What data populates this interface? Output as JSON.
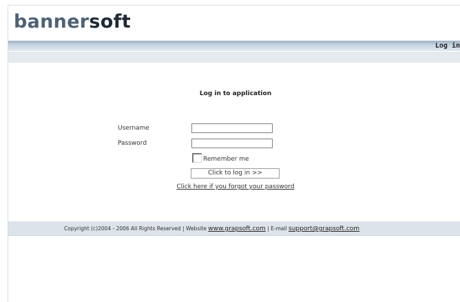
{
  "app": {
    "logo_light": "banner",
    "logo_dark": "soft"
  },
  "header": {
    "login_label": "Log in"
  },
  "login_form": {
    "title": "Log in to application",
    "username_label": "Username",
    "username_value": "",
    "password_label": "Password",
    "password_value": "",
    "remember_label": "Remember me",
    "remember_checked": false,
    "submit_label": "Click to log in >>",
    "forgot_link": "Click here if you forgot your password"
  },
  "footer": {
    "copyright": "Copyright (c)2004 - 2006 All Rights Reserved | Website ",
    "website_link": "www.grapsoft.com",
    "email_prefix": " | E-mail ",
    "email_link": "support@grapsoft.com"
  },
  "colors": {
    "header_bar": "#9eb2c4",
    "footer_bar": "#dde3ea",
    "logo_light": "#4d6276",
    "logo_dark": "#1e2a36"
  }
}
